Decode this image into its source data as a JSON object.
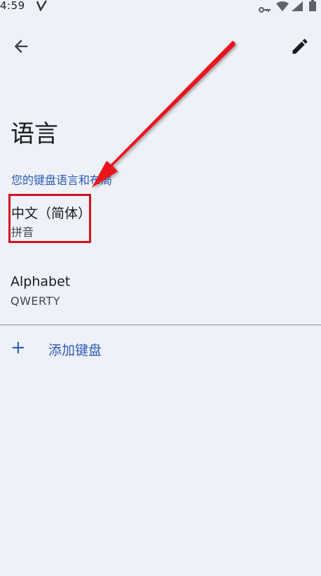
{
  "status_bar": {
    "time": "4:59"
  },
  "header": {
    "title": "语言",
    "back_icon": "arrow-back-icon",
    "edit_icon": "pencil-edit-icon"
  },
  "section": {
    "header": "您的键盘语言和布局"
  },
  "languages": [
    {
      "name": "中文（简体）",
      "layout": "拼音"
    },
    {
      "name": "Alphabet",
      "layout": "QWERTY"
    }
  ],
  "add_keyboard": {
    "icon": "+",
    "label": "添加键盘"
  },
  "annotation": {
    "arrow_color": "#e8141e",
    "box_color": "#d4141e"
  },
  "colors": {
    "background": "#eef1f8",
    "accent": "#2d5bb8"
  }
}
